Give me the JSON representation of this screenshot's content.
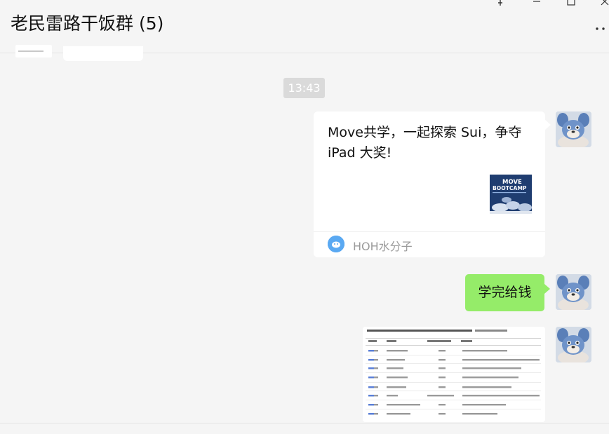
{
  "header": {
    "title": "老民雷路干饭群 (5)",
    "pin_icon": "pin-icon",
    "minimize_icon": "minimize-icon",
    "maximize_icon": "maximize-icon",
    "close_icon": "close-icon",
    "more_icon": "more-options-icon"
  },
  "messages": {
    "timestamp": "13:43",
    "link_card": {
      "title": "Move共学，一起探索 Sui，争夺 iPad 大奖!",
      "thumb_text_line1": "MOVE",
      "thumb_text_line2": "BOOTCAMP",
      "source_name": "HOH水分子"
    },
    "text_message": "学完给钱"
  },
  "colors": {
    "background": "#f5f5f5",
    "self_bubble": "#95ec69",
    "card": "#ffffff",
    "timestamp_bg": "#dadada",
    "source_icon": "#5aa9f2"
  }
}
